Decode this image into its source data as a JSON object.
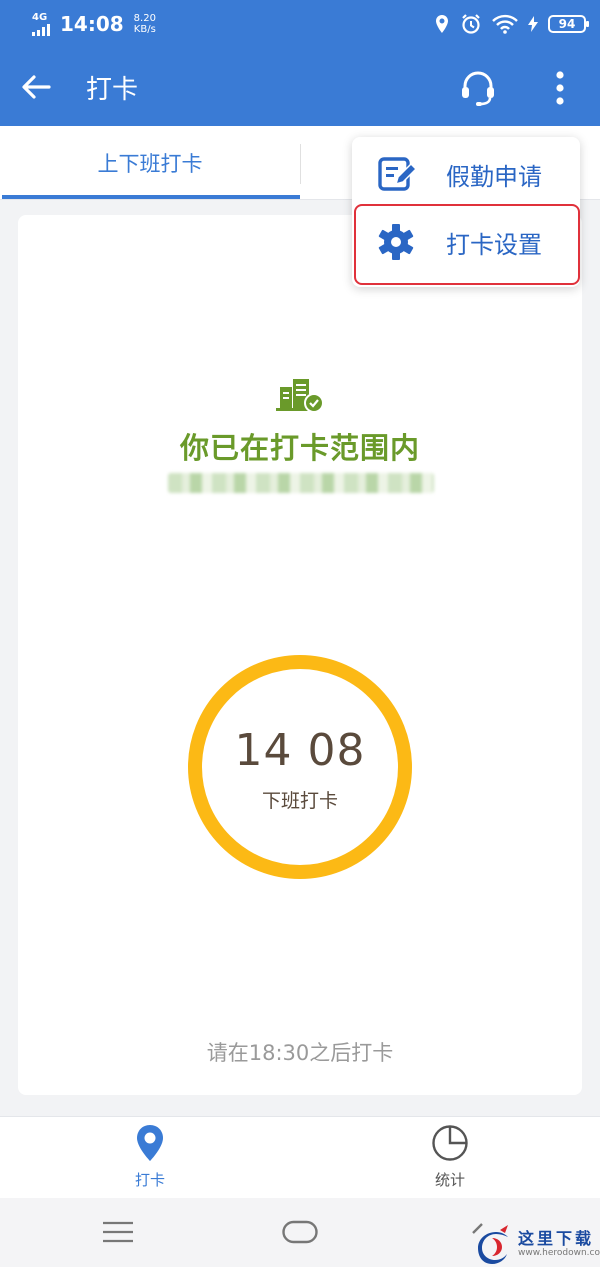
{
  "status_bar": {
    "network": "4G",
    "time": "14:08",
    "net_speed_value": "8.20",
    "net_speed_unit": "KB/s",
    "battery": "94"
  },
  "app_bar": {
    "title": "打卡",
    "back_icon": "arrow-left-icon",
    "support_icon": "headset-icon",
    "more_icon": "more-vertical-icon"
  },
  "tabs": [
    {
      "label": "上下班打卡",
      "active": true
    }
  ],
  "dropdown_menu": {
    "items": [
      {
        "label": "假勤申请",
        "icon": "edit-document-icon"
      },
      {
        "label": "打卡设置",
        "icon": "gear-icon",
        "highlighted": true
      }
    ],
    "highlight_color": "#e0313b"
  },
  "checkin_card": {
    "status_icon": "building-check-icon",
    "status_text": "你已在打卡范围内",
    "clock": {
      "time": "14 08",
      "label": "下班打卡",
      "ring_color": "#fcb915"
    },
    "hint": "请在18:30之后打卡"
  },
  "bottom_nav": [
    {
      "label": "打卡",
      "icon": "location-pin-icon",
      "active": true
    },
    {
      "label": "统计",
      "icon": "pie-chart-icon",
      "active": false
    }
  ],
  "system_nav": {
    "menu_icon": "menu-icon",
    "home_icon": "home-pill-icon",
    "back_icon": "back-chevron-icon"
  },
  "watermark": {
    "text": "这里下载",
    "url": "www.herodown.com"
  },
  "colors": {
    "primary": "#3a7bd5",
    "success": "#6a9a2a",
    "accent": "#fcb915",
    "muted": "#9a9a9a"
  }
}
